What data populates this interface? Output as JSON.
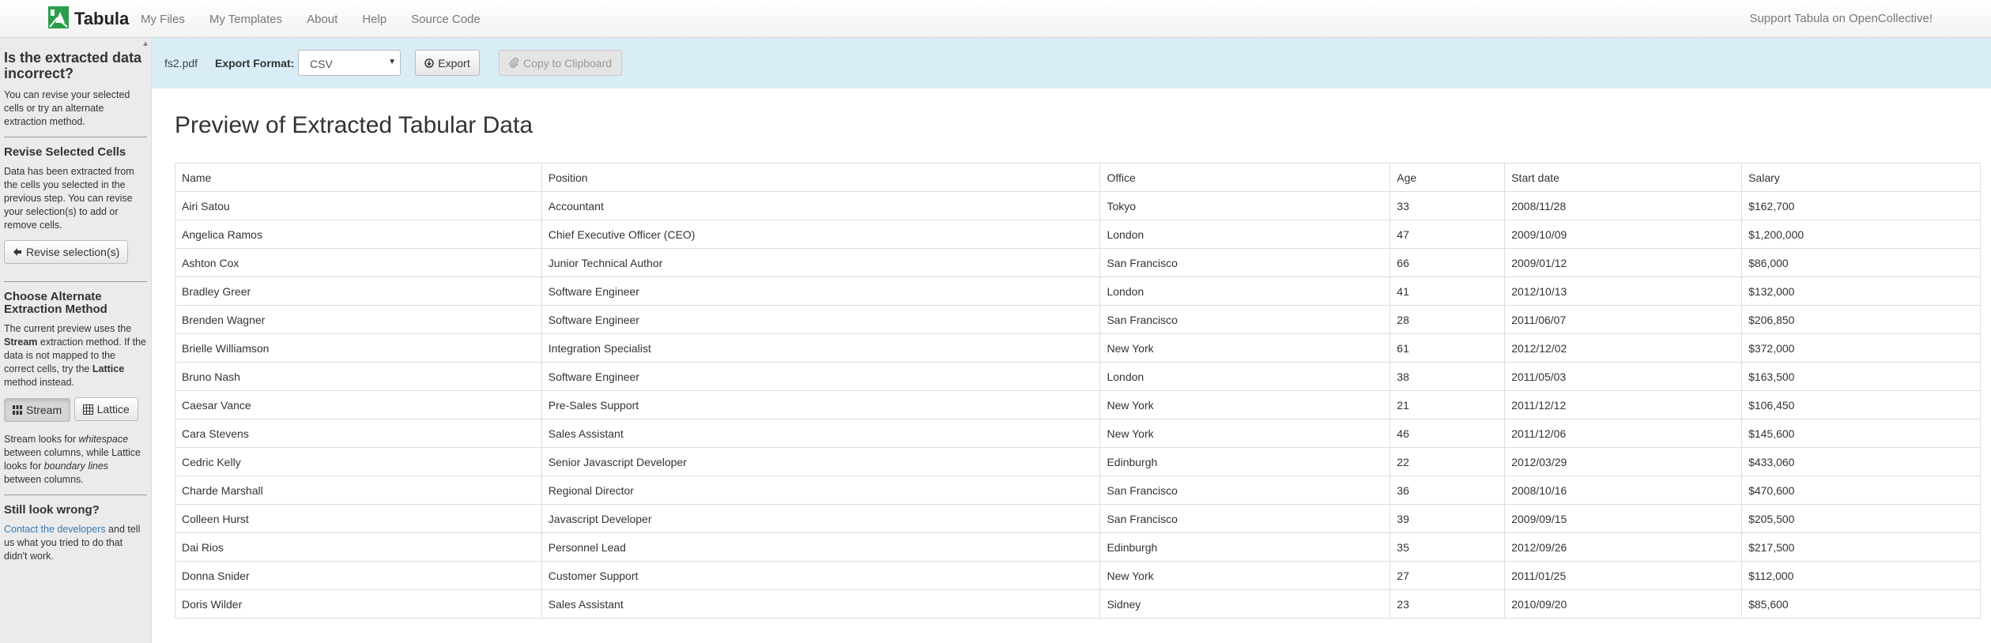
{
  "navbar": {
    "brand": "Tabula",
    "links": [
      "My Files",
      "My Templates",
      "About",
      "Help",
      "Source Code"
    ],
    "support": "Support Tabula on OpenCollective!"
  },
  "sidebar": {
    "heading": "Is the extracted data incorrect?",
    "intro": "You can revise your selected cells or try an alternate extraction method.",
    "revise_heading": "Revise Selected Cells",
    "revise_text": "Data has been extracted from the cells you selected in the previous step. You can revise your selection(s) to add or remove cells.",
    "revise_button": "Revise selection(s)",
    "method_heading": "Choose Alternate Extraction Method",
    "method_text_1": "The current preview uses the",
    "method_current": "Stream",
    "method_text_2": "extraction method. If the data is not mapped to the correct cells, try the",
    "method_alt": "Lattice",
    "method_text_3": "method instead.",
    "stream_button": "Stream",
    "lattice_button": "Lattice",
    "explain_1": "Stream looks for",
    "explain_whitespace": "whitespace",
    "explain_2": "between columns, while Lattice looks for",
    "explain_boundary": "boundary lines",
    "explain_3": "between columns.",
    "wrong_heading": "Still look wrong?",
    "contact_link": "Contact the developers",
    "contact_text": "and tell us what you tried to do that didn't work."
  },
  "toolbar": {
    "file_name": "fs2.pdf",
    "export_format_label": "Export Format:",
    "format_value": "CSV",
    "export_button": "Export",
    "copy_button": "Copy to Clipboard"
  },
  "main": {
    "title": "Preview of Extracted Tabular Data"
  },
  "table": {
    "headers": [
      "Name",
      "Position",
      "Office",
      "Age",
      "Start date",
      "Salary"
    ],
    "rows": [
      [
        "Airi Satou",
        "Accountant",
        "Tokyo",
        "33",
        "2008/11/28",
        "$162,700"
      ],
      [
        "Angelica Ramos",
        "Chief Executive Officer (CEO)",
        "London",
        "47",
        "2009/10/09",
        "$1,200,000"
      ],
      [
        "Ashton Cox",
        "Junior Technical Author",
        "San Francisco",
        "66",
        "2009/01/12",
        "$86,000"
      ],
      [
        "Bradley Greer",
        "Software Engineer",
        "London",
        "41",
        "2012/10/13",
        "$132,000"
      ],
      [
        "Brenden Wagner",
        "Software Engineer",
        "San Francisco",
        "28",
        "2011/06/07",
        "$206,850"
      ],
      [
        "Brielle Williamson",
        "Integration Specialist",
        "New York",
        "61",
        "2012/12/02",
        "$372,000"
      ],
      [
        "Bruno Nash",
        "Software Engineer",
        "London",
        "38",
        "2011/05/03",
        "$163,500"
      ],
      [
        "Caesar Vance",
        "Pre-Sales Support",
        "New York",
        "21",
        "2011/12/12",
        "$106,450"
      ],
      [
        "Cara Stevens",
        "Sales Assistant",
        "New York",
        "46",
        "2011/12/06",
        "$145,600"
      ],
      [
        "Cedric Kelly",
        "Senior Javascript Developer",
        "Edinburgh",
        "22",
        "2012/03/29",
        "$433,060"
      ],
      [
        "Charde Marshall",
        "Regional Director",
        "San Francisco",
        "36",
        "2008/10/16",
        "$470,600"
      ],
      [
        "Colleen Hurst",
        "Javascript Developer",
        "San Francisco",
        "39",
        "2009/09/15",
        "$205,500"
      ],
      [
        "Dai Rios",
        "Personnel Lead",
        "Edinburgh",
        "35",
        "2012/09/26",
        "$217,500"
      ],
      [
        "Donna Snider",
        "Customer Support",
        "New York",
        "27",
        "2011/01/25",
        "$112,000"
      ],
      [
        "Doris Wilder",
        "Sales Assistant",
        "Sidney",
        "23",
        "2010/09/20",
        "$85,600"
      ]
    ]
  },
  "colors": {
    "toolbar_bg": "#d9edf7",
    "sidebar_bg": "#ebebeb",
    "link": "#337ab7"
  }
}
